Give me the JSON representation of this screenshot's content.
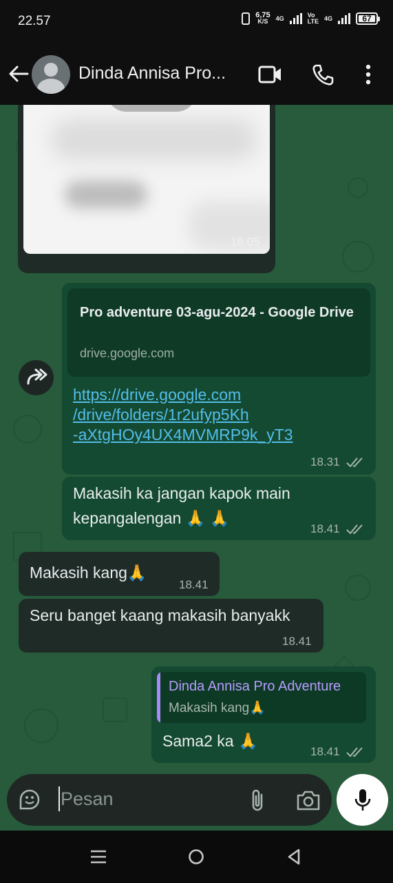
{
  "status_bar": {
    "time": "22.57",
    "speed_value": "6,75",
    "speed_unit": "K/S",
    "net1": "4G",
    "volte_top": "Vo",
    "volte_bottom": "LTE",
    "net2": "4G",
    "battery": "67"
  },
  "header": {
    "contact_name": "Dinda Annisa Pro...",
    "icons": [
      "back-arrow-icon",
      "avatar",
      "video-call-icon",
      "phone-call-icon",
      "more-vert-icon"
    ]
  },
  "messages": {
    "image": {
      "time": "18.05"
    },
    "link": {
      "preview_title": "Pro adventure 03-agu-2024 - Google Drive",
      "preview_domain": "drive.google.com",
      "url_line1": "https://drive.google.com",
      "url_line2": "/drive/folders/1r2ufyp5Kh",
      "url_line3": "-aXtgHOy4UX4MVMRP9k_yT3",
      "time": "18.31"
    },
    "thanks_out": {
      "line1": "Makasih ka jangan kapok  main",
      "line2": "kepangalengan",
      "emoji": "🙏 🙏",
      "time": "18.41"
    },
    "thanks_in": {
      "text": "Makasih kang",
      "emoji": "🙏",
      "time": "18.41"
    },
    "fun_in": {
      "text": "Seru banget kaang makasih banyakk",
      "time": "18.41"
    },
    "reply_out": {
      "quote_name": "Dinda Annisa Pro Adventure",
      "quote_text": "Makasih kang",
      "quote_emoji": "🙏",
      "text": "Sama2 ka",
      "emoji": "🙏",
      "time": "18.41"
    }
  },
  "composer": {
    "placeholder": "Pesan"
  },
  "colors": {
    "chat_bg": "#275b3b",
    "bubble_out": "#144a31",
    "bubble_in": "#1f2b27",
    "link": "#53bdeb",
    "quote_accent": "#a78bfa"
  }
}
